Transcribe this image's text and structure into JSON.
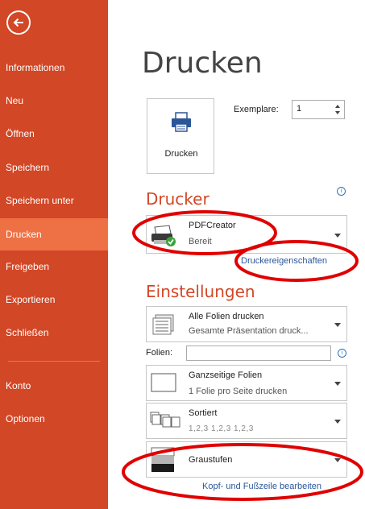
{
  "sidebar": {
    "items": [
      {
        "label": "Informationen"
      },
      {
        "label": "Neu"
      },
      {
        "label": "Öffnen"
      },
      {
        "label": "Speichern"
      },
      {
        "label": "Speichern unter"
      },
      {
        "label": "Drucken",
        "active": true
      },
      {
        "label": "Freigeben"
      },
      {
        "label": "Exportieren"
      },
      {
        "label": "Schließen"
      },
      {
        "label": "Konto"
      },
      {
        "label": "Optionen"
      }
    ]
  },
  "main": {
    "title": "Drucken",
    "print_button_label": "Drucken",
    "copies_label": "Exemplare:",
    "copies_value": "1"
  },
  "printer": {
    "heading": "Drucker",
    "name": "PDFCreator",
    "status": "Bereit",
    "properties_link": "Druckereigenschaften"
  },
  "settings": {
    "heading": "Einstellungen",
    "range_title": "Alle Folien drucken",
    "range_sub": "Gesamte Präsentation druck...",
    "slides_label": "Folien:",
    "slides_value": "",
    "layout_title": "Ganzseitige Folien",
    "layout_sub": "1 Folie pro Seite drucken",
    "collate_title": "Sortiert",
    "collate_sub": "1,2,3   1,2,3   1,2,3",
    "color_title": "Graustufen",
    "header_footer_link": "Kopf- und Fußzeile bearbeiten"
  },
  "colors": {
    "accent": "#d24726",
    "accent_active": "#ee7146",
    "link": "#2b579a",
    "annotation": "#e00000"
  }
}
